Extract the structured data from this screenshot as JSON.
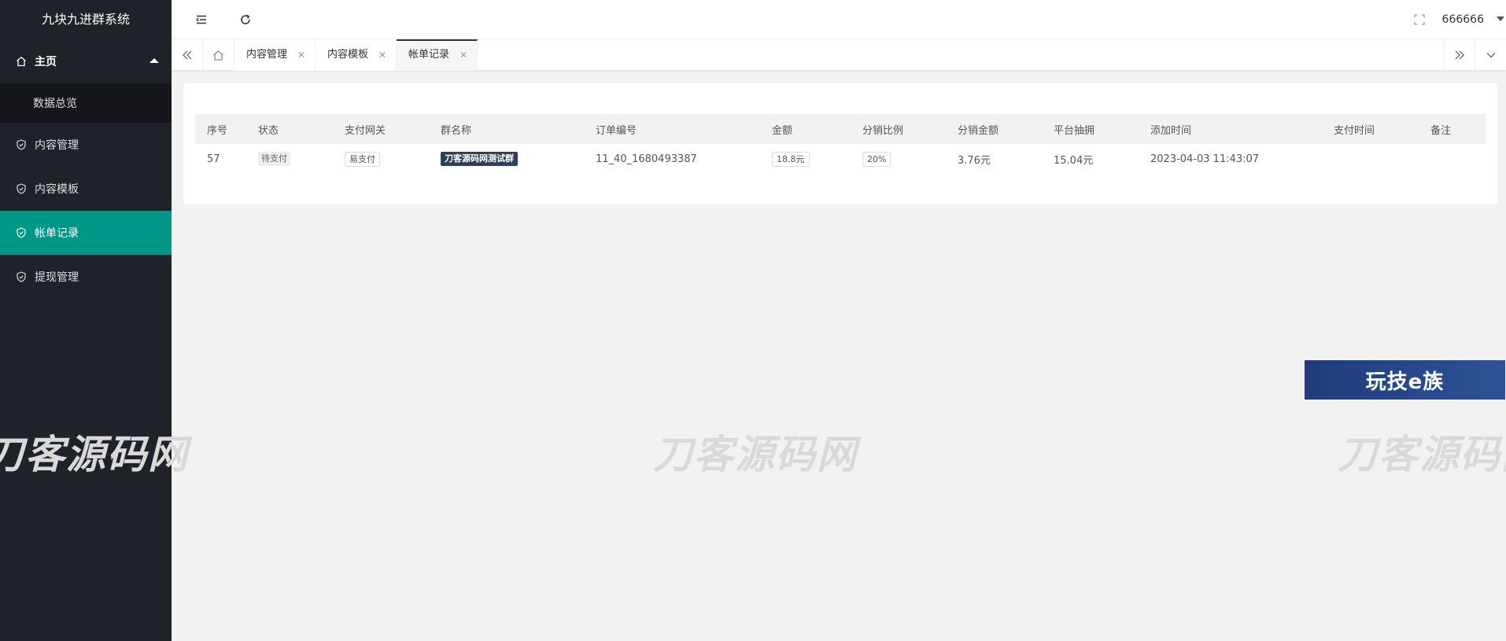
{
  "app": {
    "title": "九块九进群系统"
  },
  "sidebar": {
    "home": {
      "label": "主页",
      "icon": "home-icon"
    },
    "home_children": [
      {
        "label": "数据总览"
      }
    ],
    "items": [
      {
        "label": "内容管理",
        "icon": "shield-check-icon"
      },
      {
        "label": "内容模板",
        "icon": "shield-check-icon"
      },
      {
        "label": "帐单记录",
        "icon": "shield-check-icon",
        "active": true
      },
      {
        "label": "提现管理",
        "icon": "shield-check-icon"
      }
    ],
    "active_color": "#009688"
  },
  "header": {
    "user": "666666"
  },
  "tabs": [
    {
      "label": "内容管理"
    },
    {
      "label": "内容模板"
    },
    {
      "label": "帐单记录",
      "active": true
    }
  ],
  "table": {
    "columns": [
      "序号",
      "状态",
      "支付网关",
      "群名称",
      "订单编号",
      "金额",
      "分销比例",
      "分销金额",
      "平台抽拥",
      "添加时间",
      "支付时间",
      "备注"
    ],
    "rows": [
      {
        "id": "57",
        "status": "待支付",
        "gateway": "易支付",
        "group": "刀客源码网测试群",
        "order_no": "11_40_1680493387",
        "amount": "18.8元",
        "ratio": "20%",
        "dist_amount": "3.76元",
        "platform_fee": "15.04元",
        "added": "2023-04-03 11:43:07",
        "paid": "",
        "remark": ""
      }
    ]
  },
  "watermark": {
    "text": "刀客源码网",
    "banner": "玩技e族"
  }
}
